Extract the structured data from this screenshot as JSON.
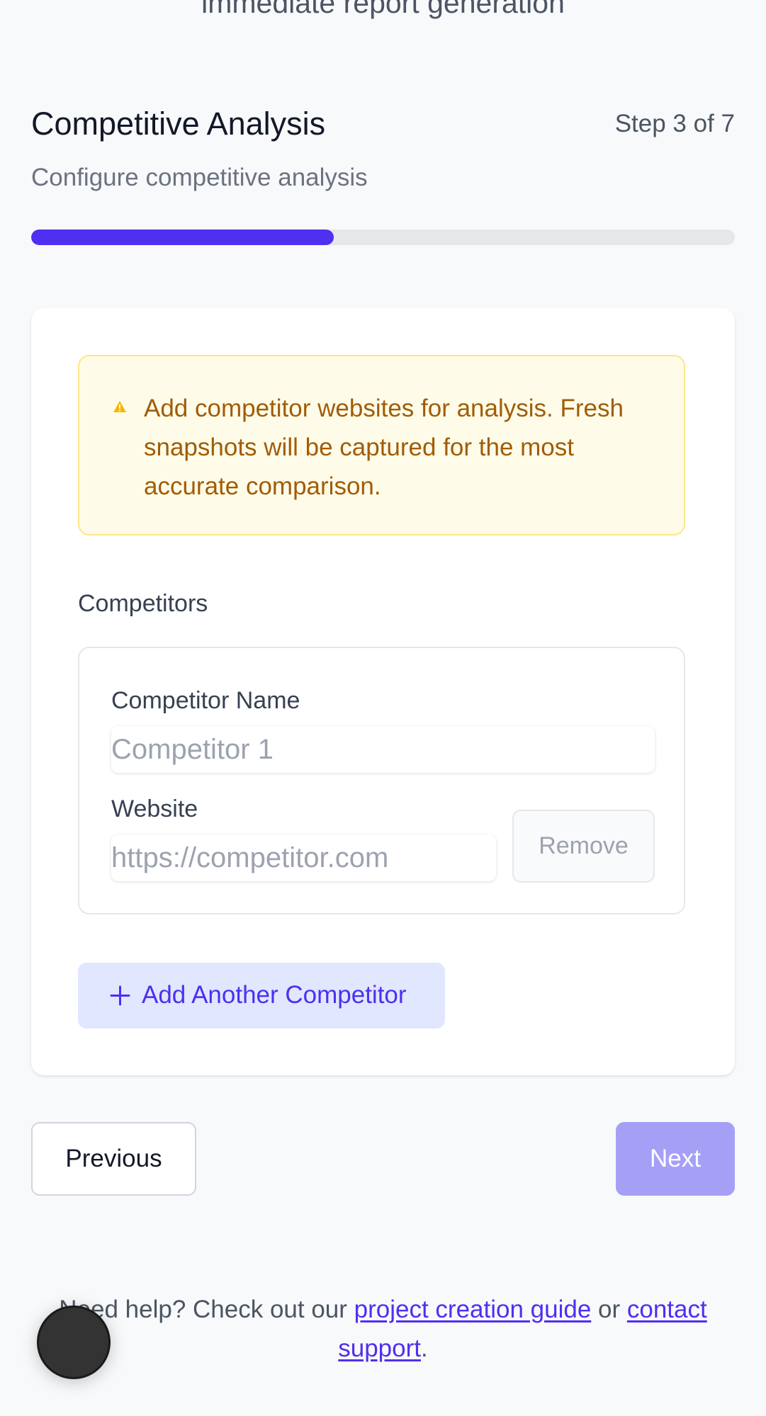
{
  "header": {
    "caption": "immediate report generation"
  },
  "step": {
    "title": "Competitive Analysis",
    "count": "Step 3 of 7",
    "subtitle": "Configure competitive analysis",
    "progress_fraction": 0.43
  },
  "notice": {
    "text": "Add competitor websites for analysis. Fresh snapshots will be captured for the most accurate comparison."
  },
  "competitors": {
    "section_label": "Competitors",
    "items": [
      {
        "name_label": "Competitor Name",
        "name_placeholder": "Competitor 1",
        "name_value": "",
        "website_label": "Website",
        "website_placeholder": "https://competitor.com",
        "website_value": "",
        "remove_label": "Remove"
      }
    ],
    "add_label": "Add Another Competitor"
  },
  "nav": {
    "previous_label": "Previous",
    "next_label": "Next"
  },
  "help": {
    "prefix": "Need help? Check out our ",
    "guide_link": "project creation guide",
    "middle": " or ",
    "support_link": "contact support",
    "suffix": "."
  },
  "colors": {
    "accent": "#4f2ff0",
    "next_disabled": "#a5a0f6",
    "notice_text": "#a15c07",
    "notice_bg": "#fefce8",
    "notice_border": "#fde68a",
    "warning_icon": "#f5b800"
  },
  "icons": {
    "notice": "warning-icon",
    "add": "plus-icon"
  }
}
